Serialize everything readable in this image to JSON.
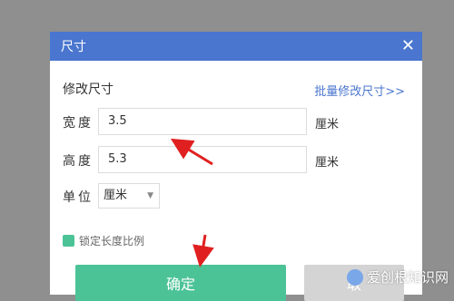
{
  "dialog": {
    "title": "尺寸",
    "close_glyph": "✕",
    "section_title": "修改尺寸",
    "batch_link": "批量修改尺寸>>",
    "width": {
      "label": "宽度",
      "value": "3.5",
      "unit": "厘米"
    },
    "height": {
      "label": "高度",
      "value": "5.3",
      "unit": "厘米"
    },
    "unit_select": {
      "label": "单位",
      "value": "厘米"
    },
    "lock_ratio": {
      "label": "锁定长度比例",
      "checked": true
    },
    "confirm_label": "确定",
    "cancel_label": "取"
  },
  "watermark": "爱创根知识网",
  "colors": {
    "titlebar": "#4a76cf",
    "accent_green": "#4cc397",
    "link_blue": "#4a76cf",
    "arrow_red": "#e02020",
    "overlay": "#8f8f8f"
  },
  "icons": [
    "close-icon",
    "dropdown-arrow-icon",
    "checkbox-icon",
    "annotation-arrow"
  ]
}
